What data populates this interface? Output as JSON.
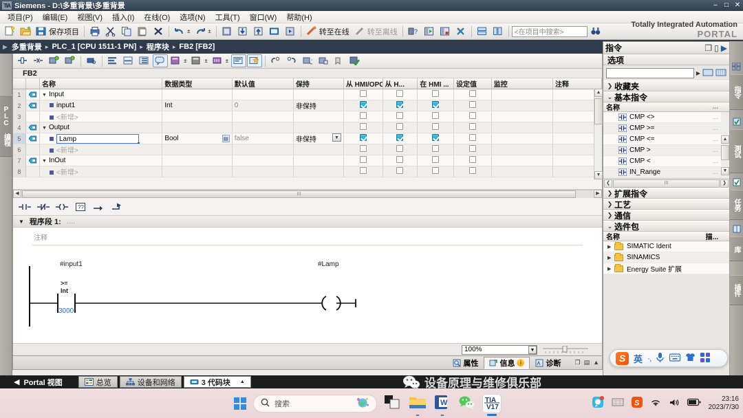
{
  "window": {
    "title": "Siemens - D:\\多重背景\\多重背景",
    "logo": "TIA",
    "buttons": [
      "–",
      "□",
      "✕"
    ]
  },
  "menu": [
    {
      "label": "项目(P)"
    },
    {
      "label": "编辑(E)"
    },
    {
      "label": "视图(V)"
    },
    {
      "label": "插入(I)"
    },
    {
      "label": "在线(O)"
    },
    {
      "label": "选项(N)"
    },
    {
      "label": "工具(T)"
    },
    {
      "label": "窗口(W)"
    },
    {
      "label": "帮助(H)"
    }
  ],
  "toolbar": {
    "save_label": "保存项目",
    "go_online_label": "转至在线",
    "go_offline_label": "转至离线",
    "search_placeholder": "<在项目中搜索>",
    "brand_line1": "Totally Integrated Automation",
    "brand_line2": "PORTAL"
  },
  "breadcrumb": {
    "items": [
      "多重背景",
      "PLC_1 [CPU 1511-1 PN]",
      "程序块",
      "FB2 [FB2]"
    ],
    "separator": "▸",
    "window_buttons": [
      "–",
      "□",
      "✕"
    ]
  },
  "left_rail": {
    "tabs": [
      "PLC 编程"
    ]
  },
  "right_rail": {
    "tabs": [
      "任务",
      "库",
      "插件"
    ]
  },
  "editor": {
    "block_name": "FB2",
    "table": {
      "headers": [
        "",
        "",
        "名称",
        "数据类型",
        "默认值",
        "保持",
        "从 HMI/OPC...",
        "从 H...",
        "在 HMI ...",
        "设定值",
        "监控",
        "注释"
      ],
      "rows": [
        {
          "num": "1",
          "kind": "section",
          "name": "Input",
          "expander": "▼",
          "datatype": "",
          "default": "",
          "retain": "",
          "hmi1": false,
          "hmi2": false,
          "hmi3": false,
          "setpoint": false,
          "monitor": "",
          "comment": "",
          "selected": false
        },
        {
          "num": "2",
          "kind": "var",
          "name": "input1",
          "expander": "",
          "datatype": "Int",
          "default": "0",
          "retain": "非保持",
          "hmi1": true,
          "hmi2": true,
          "hmi3": true,
          "setpoint": false,
          "monitor": "",
          "comment": "",
          "selected": false
        },
        {
          "num": "3",
          "kind": "new",
          "name": "<新增>",
          "expander": "",
          "datatype": "",
          "default": "",
          "retain": "",
          "hmi1": false,
          "hmi2": false,
          "hmi3": false,
          "setpoint": false,
          "monitor": "",
          "comment": "",
          "selected": false
        },
        {
          "num": "4",
          "kind": "section",
          "name": "Output",
          "expander": "▼",
          "datatype": "",
          "default": "",
          "retain": "",
          "hmi1": false,
          "hmi2": false,
          "hmi3": false,
          "setpoint": false,
          "monitor": "",
          "comment": "",
          "selected": false
        },
        {
          "num": "5",
          "kind": "var",
          "name": "Lamp",
          "expander": "",
          "datatype": "Bool",
          "default": "false",
          "retain": "非保持",
          "hmi1": true,
          "hmi2": true,
          "hmi3": true,
          "setpoint": false,
          "monitor": "",
          "comment": "",
          "selected": true
        },
        {
          "num": "6",
          "kind": "new",
          "name": "<新增>",
          "expander": "",
          "datatype": "",
          "default": "",
          "retain": "",
          "hmi1": false,
          "hmi2": false,
          "hmi3": false,
          "setpoint": false,
          "monitor": "",
          "comment": "",
          "selected": false
        },
        {
          "num": "7",
          "kind": "section",
          "name": "InOut",
          "expander": "▼",
          "datatype": "",
          "default": "",
          "retain": "",
          "hmi1": false,
          "hmi2": false,
          "hmi3": false,
          "setpoint": false,
          "monitor": "",
          "comment": "",
          "selected": false
        },
        {
          "num": "8",
          "kind": "new",
          "name": "<新增>",
          "expander": "",
          "datatype": "",
          "default": "",
          "retain": "",
          "hmi1": false,
          "hmi2": false,
          "hmi3": false,
          "setpoint": false,
          "monitor": "",
          "comment": "",
          "selected": false
        }
      ]
    },
    "network": {
      "title": "程序段 1:",
      "title_dots": "....",
      "comment": "注释",
      "contact_operand": "#input1",
      "contact_op": ">=",
      "contact_type": "Int",
      "contact_value": "3000",
      "coil_operand": "#Lamp"
    },
    "zoom": {
      "value": "100%",
      "dropdown": "▼"
    }
  },
  "info_tabs": [
    {
      "label": "属性",
      "icon": "properties-icon",
      "active": false,
      "badge": ""
    },
    {
      "label": "信息",
      "icon": "info-icon",
      "active": true,
      "badge": "i"
    },
    {
      "label": "诊断",
      "icon": "diagnostics-icon",
      "active": false,
      "badge": ""
    }
  ],
  "instructions_panel": {
    "title": "指令",
    "options_header": "选项",
    "search_value": "",
    "sections": [
      {
        "label": "收藏夹",
        "expanded": false
      },
      {
        "label": "基本指令",
        "expanded": true
      },
      {
        "label": "扩展指令",
        "expanded": false
      },
      {
        "label": "工艺",
        "expanded": false
      },
      {
        "label": "通信",
        "expanded": false
      },
      {
        "label": "选件包",
        "expanded": true
      }
    ],
    "basic_list_header": [
      "名称",
      "..."
    ],
    "basic_items": [
      {
        "label": "CMP <>"
      },
      {
        "label": "CMP >="
      },
      {
        "label": "CMP <="
      },
      {
        "label": "CMP >"
      },
      {
        "label": "CMP <"
      },
      {
        "label": "IN_Range"
      }
    ],
    "optional_list_header": [
      "名称",
      "描..."
    ],
    "optional_items": [
      {
        "label": "SIMATIC Ident"
      },
      {
        "label": "SINAMICS"
      },
      {
        "label": "Energy Suite 扩展"
      }
    ]
  },
  "portal_bar": {
    "portal_view": "Portal 视图",
    "buttons": [
      {
        "label": "总览",
        "icon": "overview-icon",
        "active": false
      },
      {
        "label": "设备和网络",
        "icon": "devices-networks-icon",
        "active": false
      },
      {
        "label": "3 代码块",
        "icon": "code-block-icon",
        "active": true,
        "count": "3"
      }
    ]
  },
  "watermark": {
    "text": "设备原理与维修俱乐部",
    "icon": "wechat-icon"
  },
  "ime_bar": {
    "logo": "S",
    "mode": "英",
    "punct": "·,",
    "items": [
      "mic-icon",
      "keyboard-icon",
      "skin-icon",
      "apps-icon"
    ]
  },
  "taskbar": {
    "search_placeholder": "搜索",
    "apps": [
      {
        "name": "task-view-icon",
        "running": false
      },
      {
        "name": "file-explorer-icon",
        "running": true
      },
      {
        "name": "word-icon",
        "running": true
      },
      {
        "name": "wechat-icon",
        "running": false
      },
      {
        "name": "tia-portal-v17-icon",
        "label": "TIA V17",
        "running": true,
        "active": true
      }
    ],
    "tray": [
      "chat-icon",
      "network-share-icon",
      "sogou-icon",
      "wifi-icon",
      "volume-icon",
      "battery-icon"
    ],
    "clock_time": "23:16",
    "clock_date": "2023/7/30"
  },
  "colors": {
    "title_bar": "#3c4a59",
    "breadcrumb": "#2f3b4a",
    "accent_blue": "#2d5fa8",
    "checkbox_on": "#16a3cc",
    "ladder_value": "#2b6ecb",
    "taskbar": "#ebd5d8"
  }
}
